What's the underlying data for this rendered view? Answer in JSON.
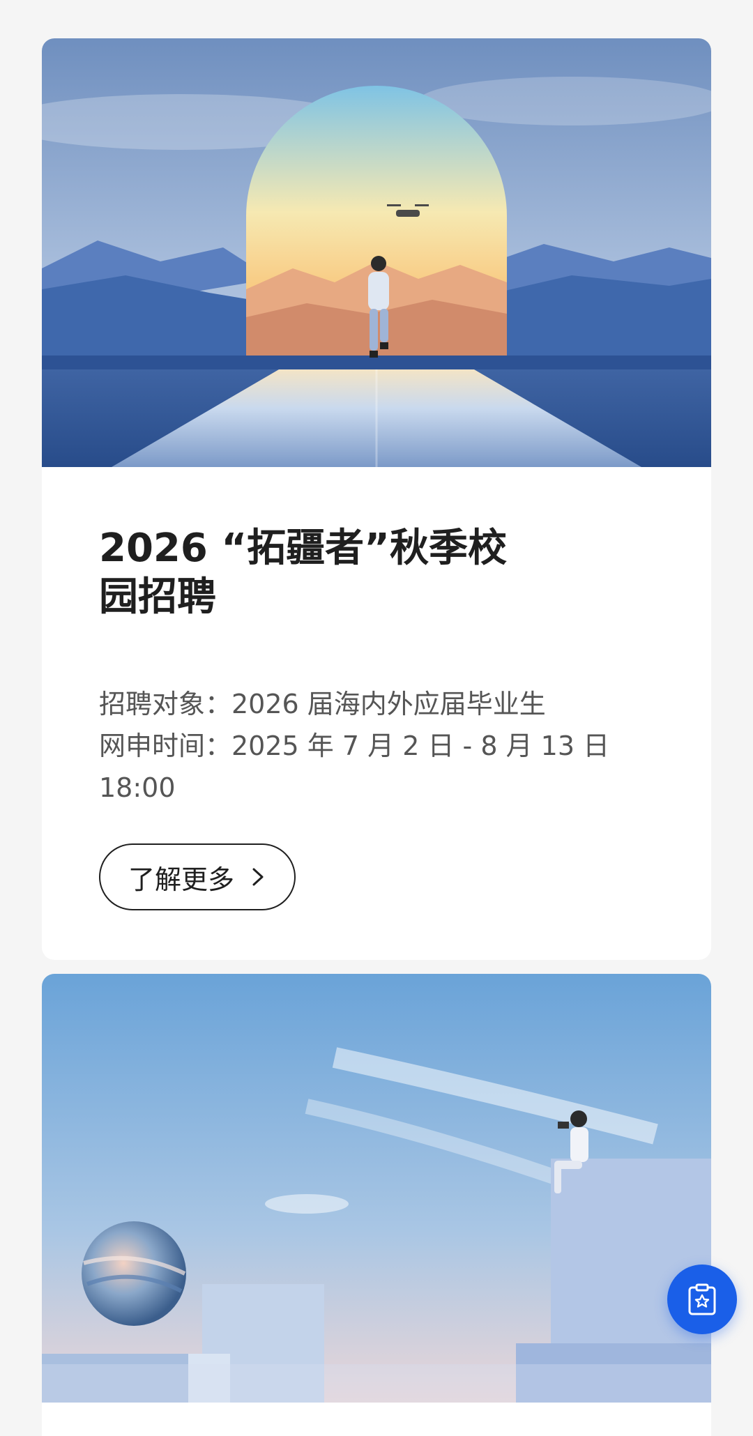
{
  "cards": [
    {
      "title": "2026 “拓疆者”秋季校园招聘",
      "info": [
        "招聘对象：2026 届海内外应届毕业生",
        "网申时间：2025 年 7 月 2 日 - 8 月 13 日 18:00"
      ],
      "button_label": "了解更多"
    }
  ],
  "icons": {
    "button_icon": "chevron-right-icon",
    "fab_icon": "clipboard-star-icon"
  },
  "colors": {
    "accent": "#1a5fe8",
    "title": "#1f1f1f",
    "body_text": "#555555",
    "page_background": "#f5f5f5"
  }
}
